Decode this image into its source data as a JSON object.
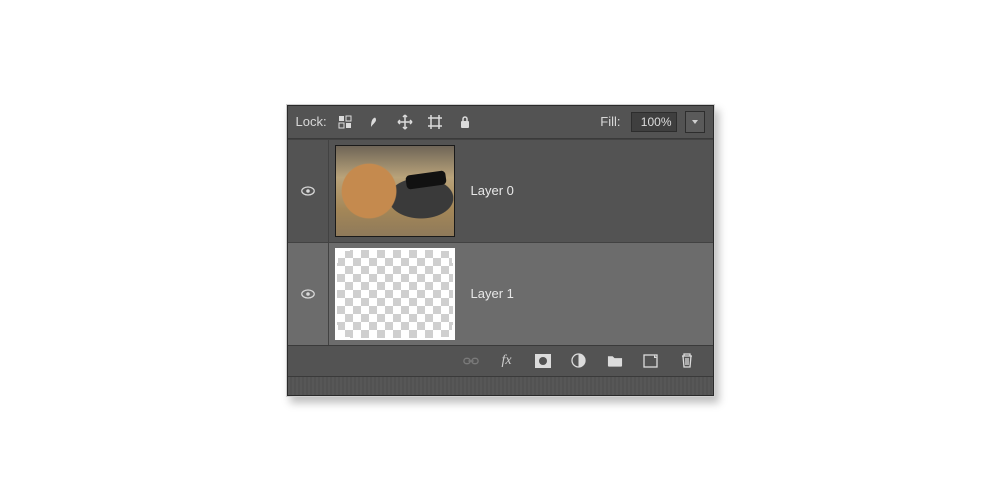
{
  "lockRow": {
    "label": "Lock:",
    "fillLabel": "Fill:",
    "fillValue": "100%"
  },
  "layers": [
    {
      "name": "Layer 0",
      "visible": true,
      "selected": false,
      "kind": "image"
    },
    {
      "name": "Layer 1",
      "visible": true,
      "selected": true,
      "kind": "transparent"
    }
  ],
  "footerIcons": [
    "link",
    "fx",
    "mask",
    "adjustment",
    "group",
    "new",
    "delete"
  ]
}
